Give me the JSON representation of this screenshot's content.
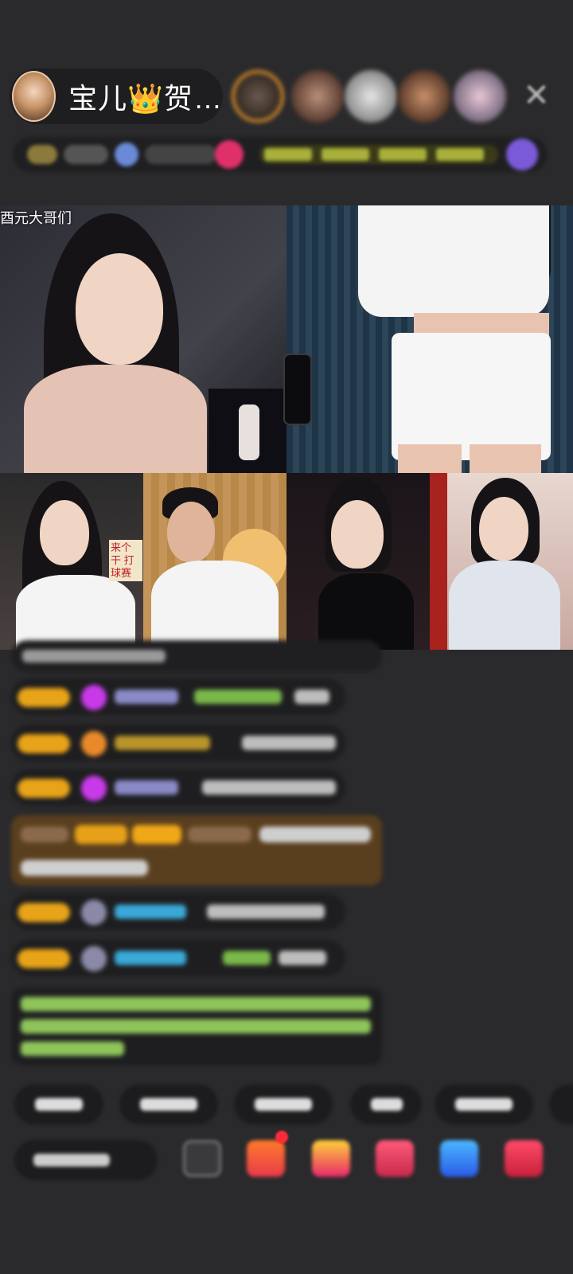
{
  "host": {
    "name": "宝儿👑贺…"
  },
  "stream": {
    "room_label": "酉元大哥们",
    "sign_text": "来个干 打球赛"
  },
  "colors": {
    "background": "#2a2a2c",
    "pill": "#1e1e20",
    "level_badge": "#e8a418",
    "gold_message": "#5a3f1e",
    "green_text": "#8fc45a"
  },
  "icons": {
    "close": "close-icon",
    "toolbar": [
      "share-icon",
      "gift-icon",
      "present-box-icon",
      "heart-gift-icon",
      "game-icon",
      "more-icon"
    ]
  }
}
